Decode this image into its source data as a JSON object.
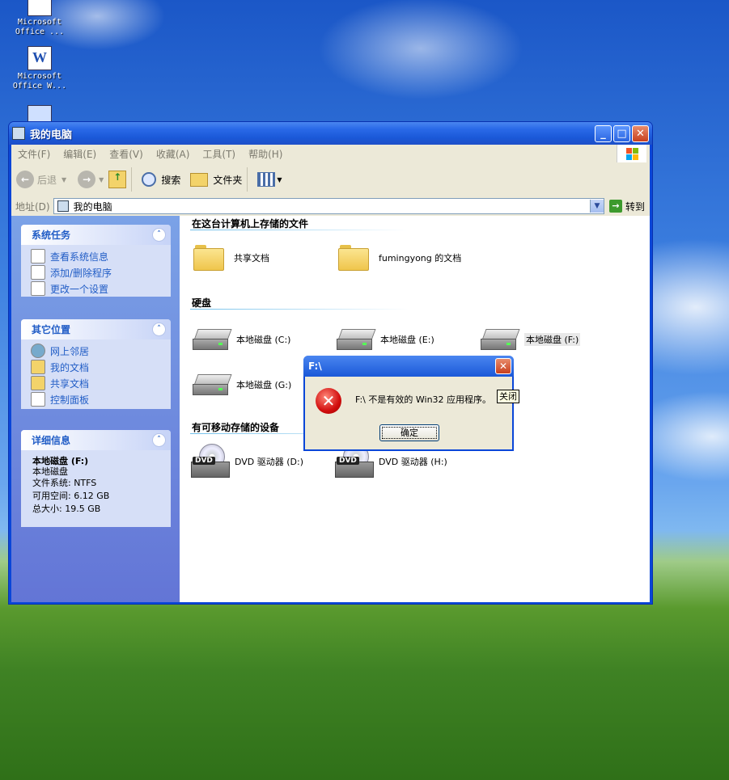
{
  "desktop": {
    "icons": [
      {
        "label": "Microsoft Office ...",
        "glyph": ""
      },
      {
        "label": "Microsoft Office W...",
        "glyph": "W"
      }
    ]
  },
  "window": {
    "title": "我的电脑",
    "controls": {
      "minimize": "_",
      "maximize": "□",
      "close": "✕"
    }
  },
  "menubar": [
    "文件(F)",
    "编辑(E)",
    "查看(V)",
    "收藏(A)",
    "工具(T)",
    "帮助(H)"
  ],
  "toolbar": {
    "back": "后退",
    "search": "搜索",
    "folders": "文件夹"
  },
  "address": {
    "label": "地址(D)",
    "value": "我的电脑",
    "go": "转到"
  },
  "left_panel": {
    "system_tasks": {
      "title": "系统任务",
      "items": [
        "查看系统信息",
        "添加/删除程序",
        "更改一个设置"
      ]
    },
    "other_places": {
      "title": "其它位置",
      "items": [
        "网上邻居",
        "我的文档",
        "共享文档",
        "控制面板"
      ]
    },
    "details": {
      "title": "详细信息",
      "name": "本地磁盘 (F:)",
      "type": "本地磁盘",
      "fs": "文件系统: NTFS",
      "free": "可用空间: 6.12 GB",
      "total": "总大小: 19.5 GB"
    }
  },
  "content": {
    "groups": {
      "files": "在这台计算机上存储的文件",
      "hard_disks": "硬盘",
      "removable": "有可移动存储的设备"
    },
    "folders": [
      "共享文档",
      "fumingyong 的文档"
    ],
    "drives": [
      "本地磁盘 (C:)",
      "本地磁盘 (E:)",
      "本地磁盘 (F:)",
      "本地磁盘 (G:)"
    ],
    "dvd": [
      "DVD 驱动器 (D:)",
      "DVD 驱动器 (H:)"
    ],
    "dvd_tag": "DVD"
  },
  "dialog": {
    "title": "F:\\",
    "message": "F:\\ 不是有效的 Win32 应用程序。",
    "ok": "确定",
    "close": "✕",
    "tooltip": "关闭"
  }
}
